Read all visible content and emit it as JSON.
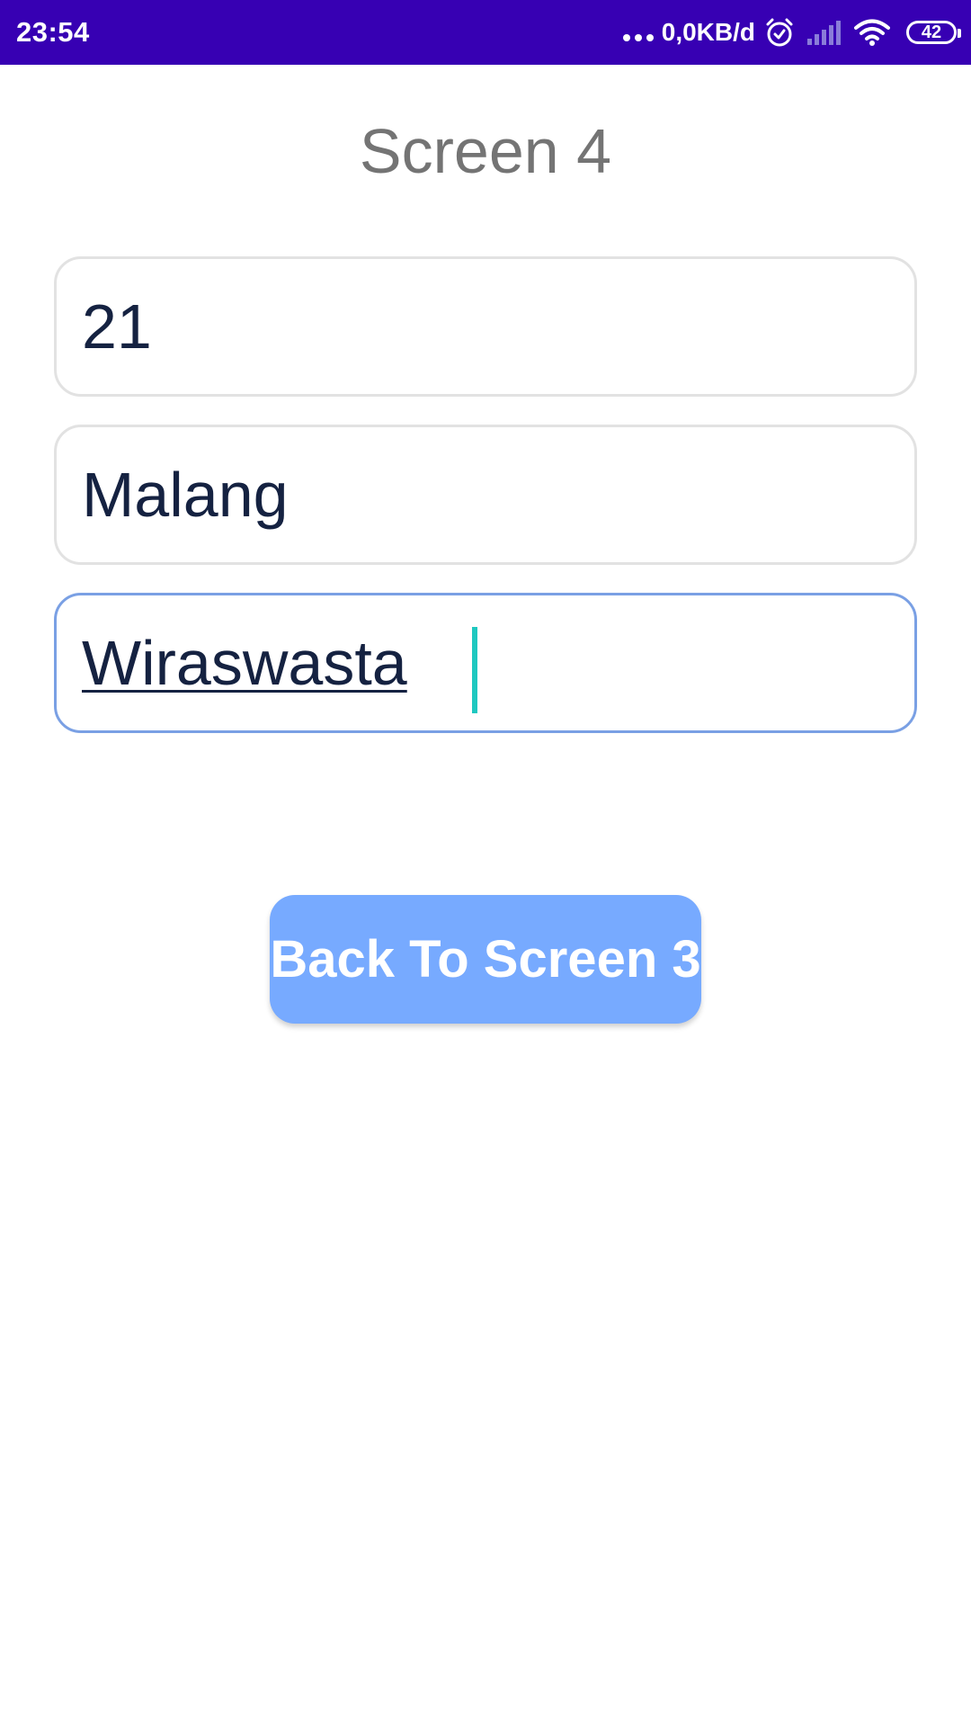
{
  "status_bar": {
    "time": "23:54",
    "net_speed": "0,0KB/d",
    "battery_level": "42",
    "icons": [
      "more-dots-icon",
      "alarm-icon",
      "signal-icon",
      "wifi-icon",
      "battery-icon"
    ],
    "background_color": "#3700b3"
  },
  "screen": {
    "title": "Screen 4"
  },
  "form": {
    "fields": [
      {
        "value": "21",
        "focused": false
      },
      {
        "value": "Malang",
        "focused": false
      },
      {
        "value": "Wiraswasta",
        "focused": true
      }
    ]
  },
  "actions": {
    "back_label": "Back To Screen 3"
  },
  "colors": {
    "accent_button": "#77aaff",
    "focused_border": "#7aa0e4",
    "text_cursor": "#1ec8c0",
    "field_text": "#152241",
    "title_text": "#747474"
  }
}
